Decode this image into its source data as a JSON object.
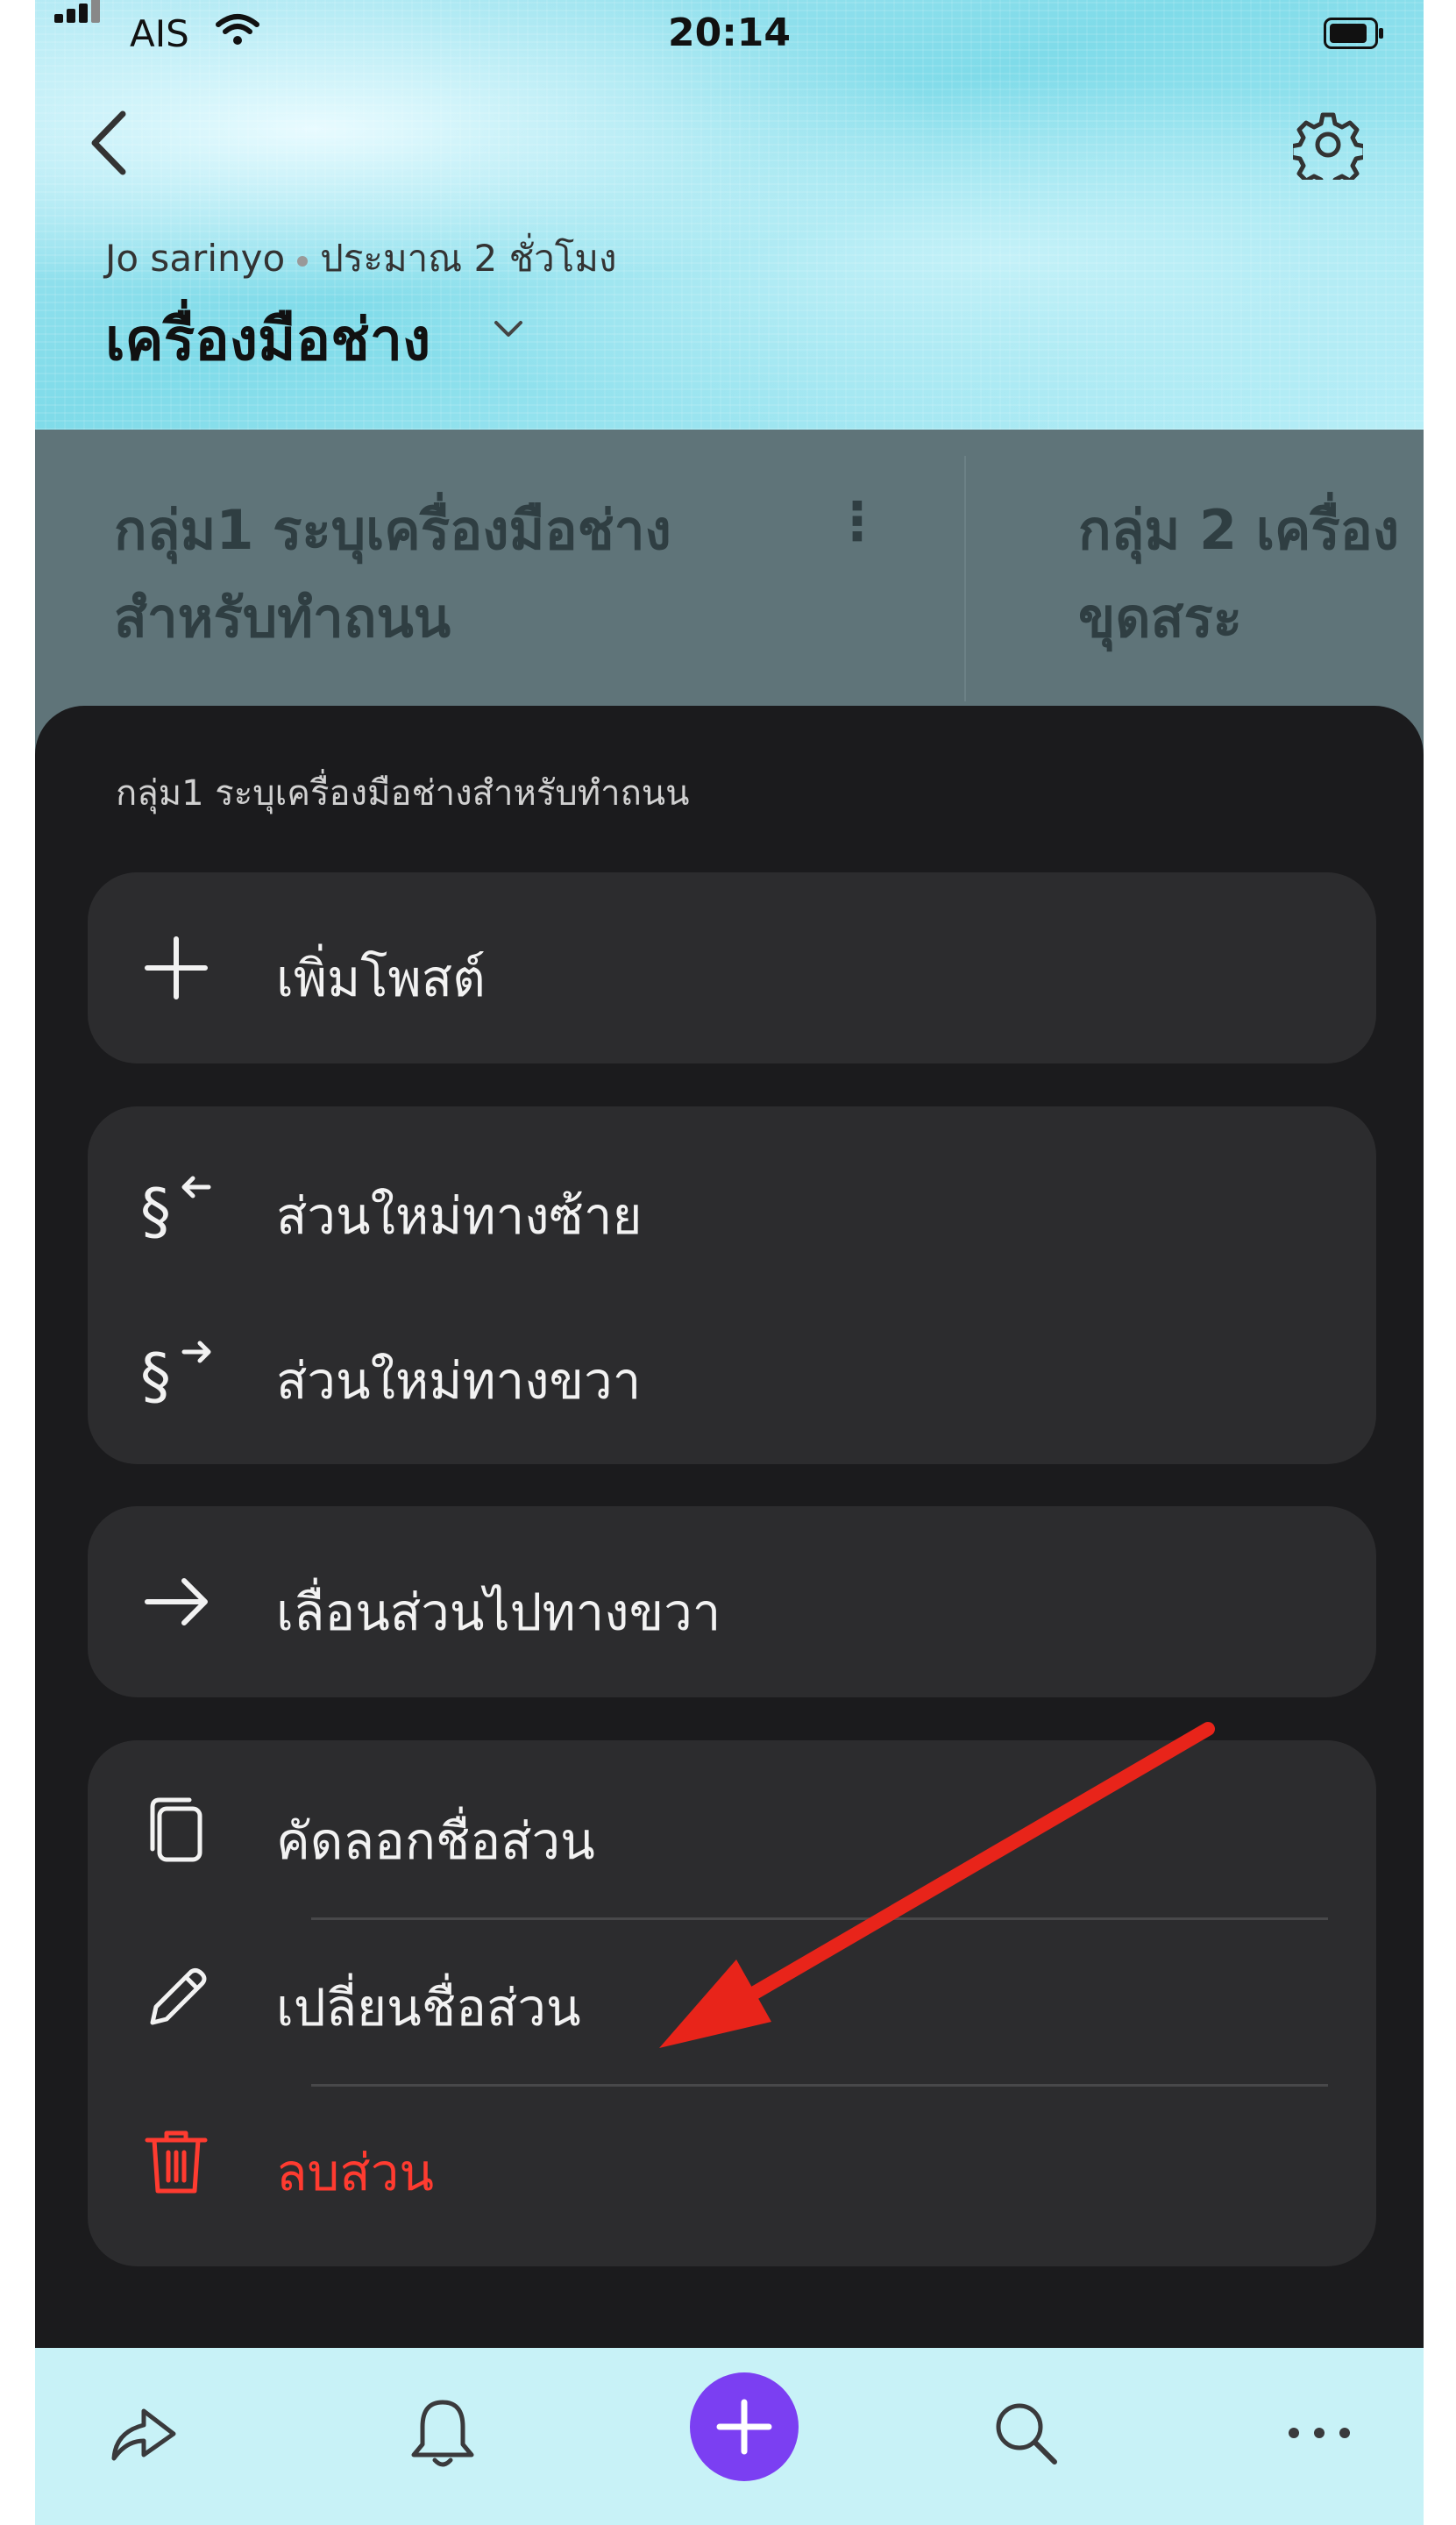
{
  "status_bar": {
    "carrier": "AIS",
    "time": "20:14"
  },
  "header": {
    "author": "Jo sarinyo",
    "time_ago": "ประมาณ 2 ชั่วโมง",
    "board_title": "เครื่องมือช่าง",
    "icons": [
      "back-icon",
      "gear-icon",
      "chevron-down-icon"
    ]
  },
  "columns": [
    {
      "title_line1": "กลุ่ม1 ระบุเครื่องมือช่าง",
      "title_line2": "สำหรับทำถนน"
    },
    {
      "title_line1": "กลุ่ม 2 เครื่อง",
      "title_line2": "ขุดสระ"
    }
  ],
  "sheet": {
    "title": "กลุ่ม1 ระบุเครื่องมือช่างสำหรับทำถนน",
    "add_post": "เพิ่มโพสต์",
    "new_section_left": "ส่วนใหม่ทางซ้าย",
    "new_section_right": "ส่วนใหม่ทางขวา",
    "move_section_right": "เลื่อนส่วนไปทางขวา",
    "copy_section_name": "คัดลอกชื่อส่วน",
    "rename_section": "เปลี่ยนชื่อส่วน",
    "delete_section": "ลบส่วน"
  },
  "tabbar": {
    "icons": [
      "share-icon",
      "bell-icon",
      "add-icon",
      "search-icon",
      "more-icon"
    ]
  },
  "colors": {
    "accent": "#7b3ff2",
    "danger": "#ff3b30",
    "annotation_arrow": "#e8241a"
  }
}
